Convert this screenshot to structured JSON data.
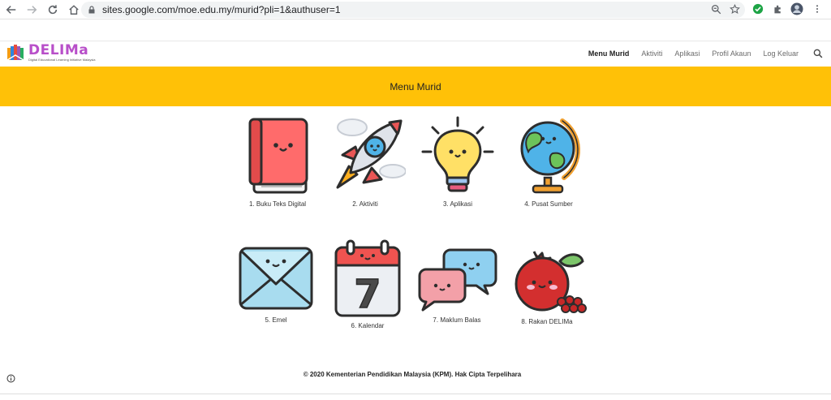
{
  "browser": {
    "url": "sites.google.com/moe.edu.my/murid?pli=1&authuser=1"
  },
  "site": {
    "logo_text": "DELIMa",
    "logo_tagline": "Digital Educational Learning Initiative Malaysia",
    "nav": [
      {
        "label": "Menu Murid"
      },
      {
        "label": "Aktiviti"
      },
      {
        "label": "Aplikasi"
      },
      {
        "label": "Profil Akaun"
      },
      {
        "label": "Log Keluar"
      }
    ],
    "banner_title": "Menu Murid",
    "accent_color": "#ffc107",
    "brand_color": "#b84fc9"
  },
  "menu": [
    {
      "label": "1. Buku Teks Digital",
      "icon": "book-icon"
    },
    {
      "label": "2. Aktiviti",
      "icon": "rocket-icon"
    },
    {
      "label": "3. Aplikasi",
      "icon": "lightbulb-icon"
    },
    {
      "label": "4. Pusat Sumber",
      "icon": "globe-icon"
    },
    {
      "label": "5. Emel",
      "icon": "envelope-icon"
    },
    {
      "label": "6. Kalendar",
      "icon": "calendar-icon"
    },
    {
      "label": "7. Maklum Balas",
      "icon": "chat-bubbles-icon"
    },
    {
      "label": "8. Rakan DELIMa",
      "icon": "pomegranate-icon"
    }
  ],
  "calendar_day": "7",
  "footer": "© 2020 Kementerian Pendidikan Malaysia (KPM). Hak Cipta Terpelihara"
}
